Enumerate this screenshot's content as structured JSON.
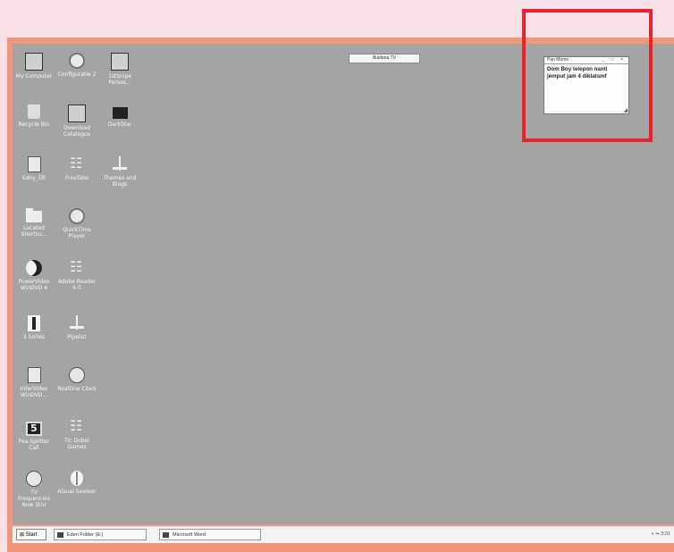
{
  "desktop": {
    "icons": [
      {
        "label": "My Computer",
        "icon": "computer-icon"
      },
      {
        "label": "Recycle Bin",
        "icon": "recycle-bin-icon"
      },
      {
        "label": "Edny_ER",
        "icon": "document-icon"
      },
      {
        "label": "Located Shortcu...",
        "icon": "folder-icon"
      },
      {
        "label": "PowerVideo WinDVD 4",
        "icon": "media-player-icon"
      },
      {
        "label": "3 Series",
        "icon": "person-icon"
      },
      {
        "label": "InterVideo WinDVD...",
        "icon": "document-icon"
      },
      {
        "label": "Pea Splitter Call",
        "icon": "screen-icon"
      },
      {
        "label": "TV Frequencies Now (En)",
        "icon": "globe-icon"
      },
      {
        "label": "Configuratie 2",
        "icon": "disc-icon"
      },
      {
        "label": "Download Catalogus",
        "icon": "box-icon"
      },
      {
        "label": "FreeTabs",
        "icon": "network-icon"
      },
      {
        "label": "QuickTime Player",
        "icon": "quicktime-icon"
      },
      {
        "label": "Adobe Reader 6.0",
        "icon": "reader-icon"
      },
      {
        "label": "Pipelist",
        "icon": "tower-icon"
      },
      {
        "label": "RealOne Clock",
        "icon": "clock-icon"
      },
      {
        "label": "Tic Dubei Games",
        "icon": "games-icon"
      },
      {
        "label": "Alauai Sealeer",
        "icon": "oval-icon"
      },
      {
        "label": "1stSnipe Persos...",
        "icon": "tag-icon"
      },
      {
        "label": "DarkStar",
        "icon": "camera-icon"
      },
      {
        "label": "Themes and Blogs",
        "icon": "lamp-icon"
      }
    ]
  },
  "tooltip": {
    "text": "Buldana TV"
  },
  "sticky_note": {
    "title": "Pan Memo",
    "controls": "_ □ ×",
    "text": "Dom Boy telepon nanti jemput jam 4 diklatsmf"
  },
  "taskbar": {
    "start_label": "Start",
    "tasks": [
      {
        "label": "Eden Folder (E:)"
      },
      {
        "label": "Microsoft Word"
      }
    ],
    "tray": "« ⏦ 3:31"
  },
  "colors": {
    "highlight": "#e8232b",
    "frame": "#f2967a",
    "page_bg": "#f7e0e6",
    "desktop_bg": "#a4a4a4"
  }
}
